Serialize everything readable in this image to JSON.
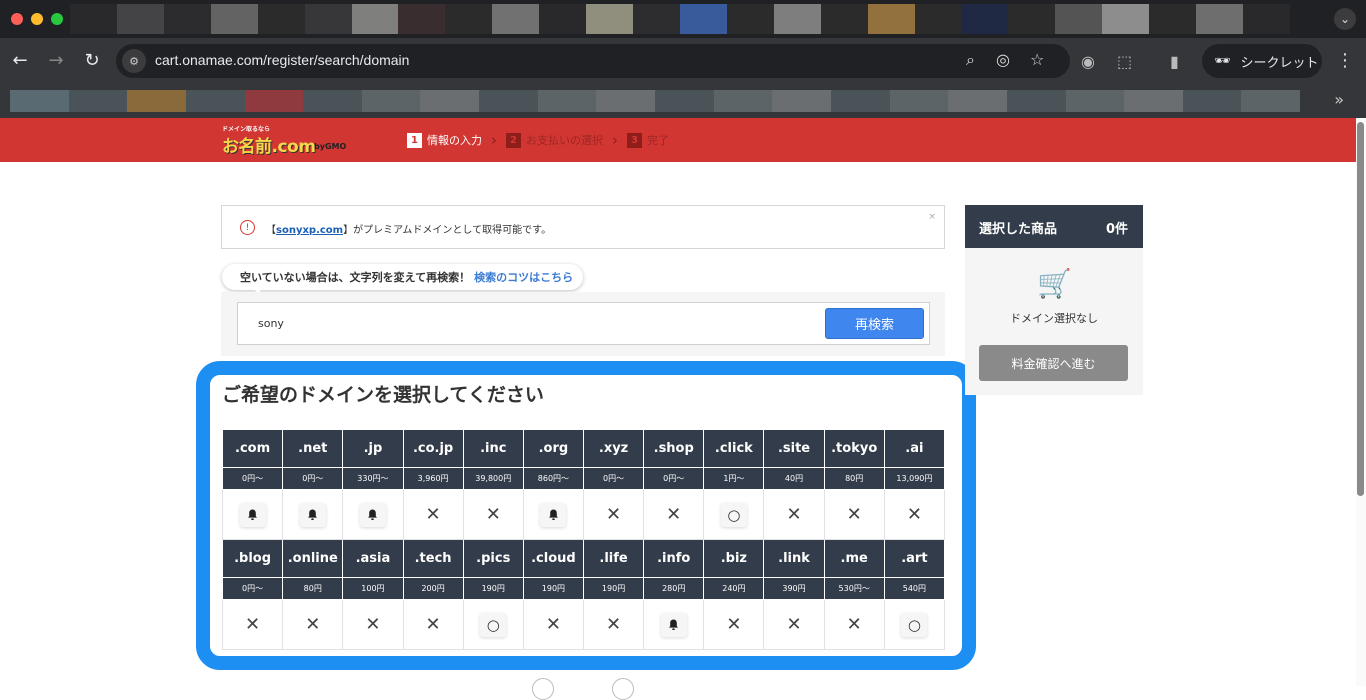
{
  "browser": {
    "url": "cart.onamae.com/register/search/domain",
    "incognito_label": "シークレット",
    "colors": {
      "close": "#ff5f57",
      "minimize": "#febc2e",
      "maximize": "#28c840"
    }
  },
  "header": {
    "logo_tagline": "ドメイン取るなら",
    "logo_text": "お名前.com",
    "logo_by": "byGMO",
    "steps": [
      {
        "num": "1",
        "label": "情報の入力",
        "active": true
      },
      {
        "num": "2",
        "label": "お支払いの選択",
        "active": false
      },
      {
        "num": "3",
        "label": "完了",
        "active": false
      }
    ]
  },
  "alert": {
    "bracket_open": "【",
    "domain_link": "sonyxp.com",
    "message": "】がプレミアムドメインとして取得可能です。",
    "close": "×"
  },
  "search": {
    "tip": "空いていない場合は、文字列を変えて再検索！",
    "tip_link": "検索のコツはこちら",
    "value": "sony",
    "button_label": "再検索"
  },
  "domain_section": {
    "title": "ご希望のドメインを選択してください",
    "rows": [
      {
        "tlds": [
          {
            "tld": ".com",
            "price": "0円〜",
            "status": "bell"
          },
          {
            "tld": ".net",
            "price": "0円〜",
            "status": "bell"
          },
          {
            "tld": ".jp",
            "price": "330円〜",
            "status": "bell"
          },
          {
            "tld": ".co.jp",
            "price": "3,960円",
            "status": "unavailable"
          },
          {
            "tld": ".inc",
            "price": "39,800円",
            "status": "unavailable"
          },
          {
            "tld": ".org",
            "price": "860円〜",
            "status": "bell"
          },
          {
            "tld": ".xyz",
            "price": "0円〜",
            "status": "unavailable"
          },
          {
            "tld": ".shop",
            "price": "0円〜",
            "status": "unavailable"
          },
          {
            "tld": ".click",
            "price": "1円〜",
            "status": "available"
          },
          {
            "tld": ".site",
            "price": "40円",
            "status": "unavailable"
          },
          {
            "tld": ".tokyo",
            "price": "80円",
            "status": "unavailable"
          },
          {
            "tld": ".ai",
            "price": "13,090円",
            "status": "unavailable"
          }
        ]
      },
      {
        "tlds": [
          {
            "tld": ".blog",
            "price": "0円〜",
            "status": "unavailable"
          },
          {
            "tld": ".online",
            "price": "80円",
            "status": "unavailable"
          },
          {
            "tld": ".asia",
            "price": "100円",
            "status": "unavailable"
          },
          {
            "tld": ".tech",
            "price": "200円",
            "status": "unavailable"
          },
          {
            "tld": ".pics",
            "price": "190円",
            "status": "available"
          },
          {
            "tld": ".cloud",
            "price": "190円",
            "status": "unavailable"
          },
          {
            "tld": ".life",
            "price": "190円",
            "status": "unavailable"
          },
          {
            "tld": ".info",
            "price": "280円",
            "status": "bell"
          },
          {
            "tld": ".biz",
            "price": "240円",
            "status": "unavailable"
          },
          {
            "tld": ".link",
            "price": "390円",
            "status": "unavailable"
          },
          {
            "tld": ".me",
            "price": "530円〜",
            "status": "unavailable"
          },
          {
            "tld": ".art",
            "price": "540円",
            "status": "available"
          }
        ]
      }
    ],
    "status_glyphs": {
      "bell": "🔔",
      "unavailable": "✕",
      "available": "○"
    }
  },
  "cart": {
    "title": "選択した商品",
    "count": "0件",
    "empty_text": "ドメイン選択なし",
    "button_label": "料金確認へ進む"
  }
}
